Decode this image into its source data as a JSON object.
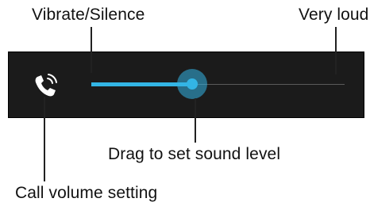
{
  "callouts": {
    "vibrate_silence": "Vibrate/Silence",
    "very_loud": "Very loud",
    "drag_hint": "Drag to set sound level",
    "call_volume": "Call volume setting"
  },
  "volume_panel": {
    "icon": "phone-ringing-icon",
    "slider": {
      "level": 0.41,
      "accent_color": "#33b5e5"
    }
  }
}
